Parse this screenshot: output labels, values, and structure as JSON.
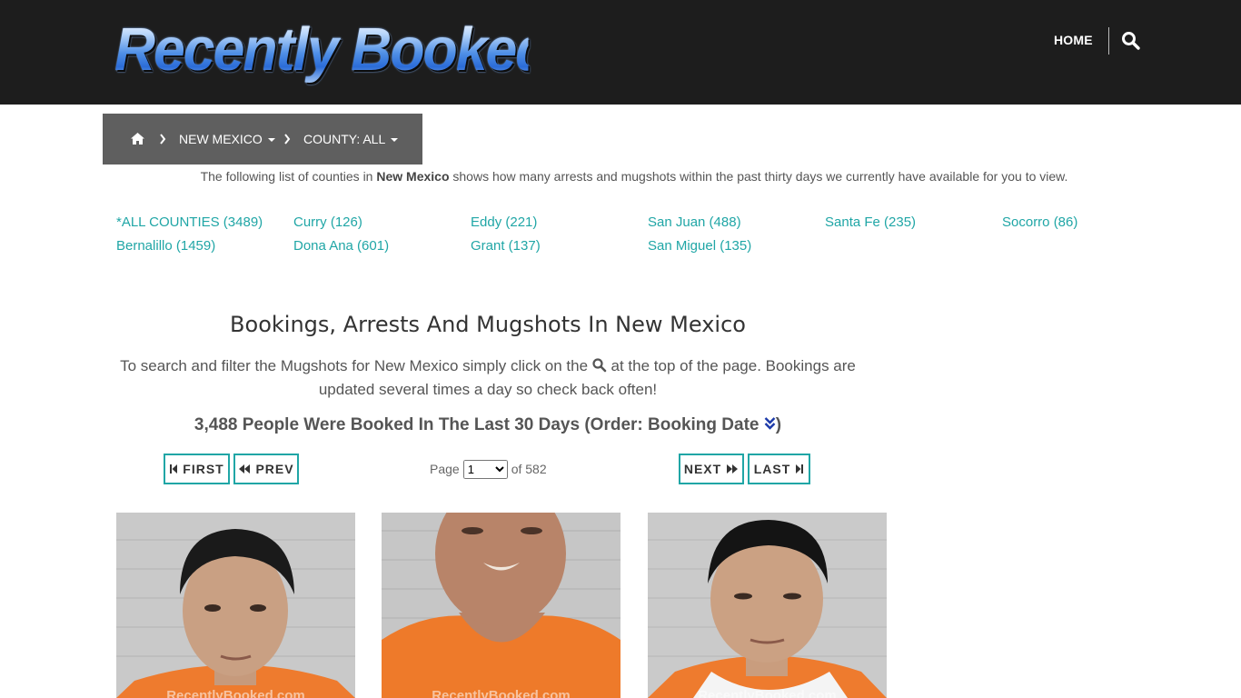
{
  "header": {
    "logo_text": "Recently Booked",
    "nav_home": "HOME",
    "search_icon": "search-icon"
  },
  "breadcrumb": {
    "home_icon": "home-icon",
    "state": "NEW MEXICO",
    "county": "COUNTY: ALL"
  },
  "intro": {
    "before": "The following list of counties in ",
    "state": "New Mexico",
    "after": " shows how many arrests and mugshots within the past thirty days we currently have available for you to view."
  },
  "counties": [
    "*ALL COUNTIES (3489)",
    "Curry (126)",
    "Eddy (221)",
    "San Juan (488)",
    "Santa Fe (235)",
    "Socorro (86)",
    "Bernalillo (1459)",
    "Dona Ana (601)",
    "Grant (137)",
    "San Miguel (135)"
  ],
  "main": {
    "heading": "Bookings, Arrests And Mugshots In New Mexico",
    "para_before": "To search and filter the Mugshots for New Mexico simply click on the ",
    "para_after": " at the top of the page. Bookings are updated several times a day so check back often!",
    "count_text": "3,488 People Were Booked In The Last 30 Days (Order: Booking Date ",
    "count_close": ")"
  },
  "pagination": {
    "first": "FIRST",
    "prev": "PREV",
    "next": "NEXT",
    "last": "LAST",
    "page_label": "Page",
    "page_value": "1",
    "of_label": "of 582"
  },
  "mugshots": {
    "watermark": "RecentlyBooked.com",
    "colors": {
      "jumpsuit": "#f07a2c",
      "wall": "#c8c8c8"
    }
  },
  "colors": {
    "header_bg": "#1d1d1d",
    "breadcrumb_bg": "#5f5f5f",
    "link": "#20a6a6"
  }
}
